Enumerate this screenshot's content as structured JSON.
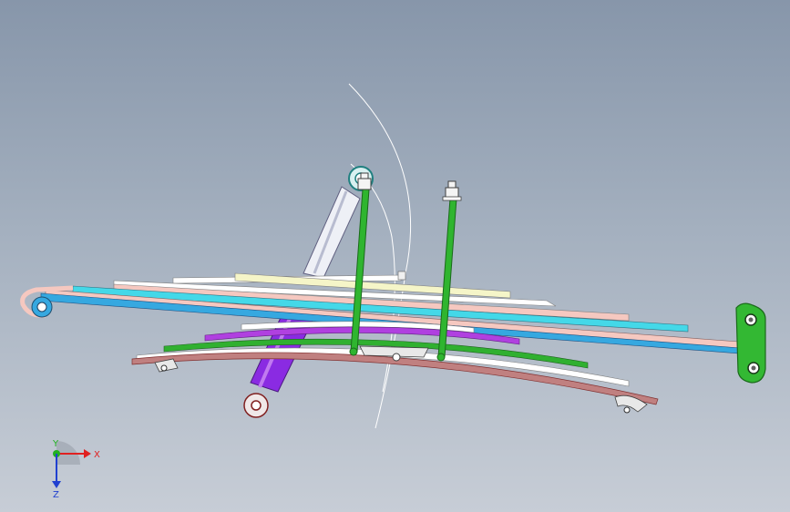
{
  "scene": {
    "description_none": "",
    "background_top": "#8796aa",
    "background_bottom": "#c7cdd6"
  },
  "triad": {
    "x_label": "X",
    "y_label": "Y",
    "z_label": "Z",
    "x_color": "#e02020",
    "y_color": "#20b020",
    "z_color": "#2040d0"
  },
  "parts": {
    "leaf_colors": [
      "#ffffff",
      "#f5f5c8",
      "#f5c8c0",
      "#44d8e8",
      "#36a8e0",
      "#d0a8a0"
    ],
    "rebound_leaf_colors": [
      "#ffffff",
      "#30b030",
      "#b040e0",
      "#c08080"
    ],
    "u_bolt_color": "#2fb52f",
    "shackle_color": "#33b833",
    "shock_body_color": "#8a2be2",
    "shock_rod_color": "#e8e8f0"
  }
}
